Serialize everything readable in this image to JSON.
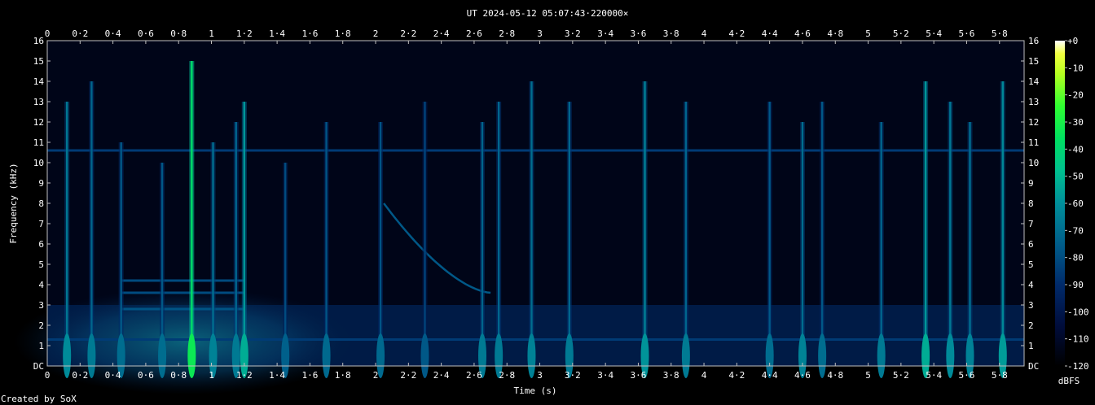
{
  "chart_data": {
    "type": "heatmap",
    "title": "UT 2024-05-12 05:07:43·220000×",
    "xlabel": "Time (s)",
    "ylabel": "Frequency (kHz)",
    "xlim": [
      0,
      5.95
    ],
    "ylim": [
      0,
      16
    ],
    "x_ticks": [
      "0",
      "0·2",
      "0·4",
      "0·6",
      "0·8",
      "1",
      "1·2",
      "1·4",
      "1·6",
      "1·8",
      "2",
      "2·2",
      "2·4",
      "2·6",
      "2·8",
      "3",
      "3·2",
      "3·4",
      "3·6",
      "3·8",
      "4",
      "4·2",
      "4·4",
      "4·6",
      "4·8",
      "5",
      "5·2",
      "5·4",
      "5·6",
      "5·8"
    ],
    "x_tick_values": [
      0,
      0.2,
      0.4,
      0.6,
      0.8,
      1,
      1.2,
      1.4,
      1.6,
      1.8,
      2,
      2.2,
      2.4,
      2.6,
      2.8,
      3,
      3.2,
      3.4,
      3.6,
      3.8,
      4,
      4.2,
      4.4,
      4.6,
      4.8,
      5,
      5.2,
      5.4,
      5.6,
      5.8
    ],
    "y_ticks": [
      "DC",
      "1",
      "2",
      "3",
      "4",
      "5",
      "6",
      "7",
      "8",
      "9",
      "10",
      "11",
      "12",
      "13",
      "14",
      "15",
      "16"
    ],
    "colorbar": {
      "label": "dBFS",
      "ticks": [
        "+0",
        "-10",
        "-20",
        "-30",
        "-40",
        "-50",
        "-60",
        "-70",
        "-80",
        "-90",
        "-100",
        "-110",
        "-120"
      ],
      "range": [
        -120,
        0
      ],
      "colors": [
        "#ffffff",
        "#f2ff40",
        "#b8ff20",
        "#30ff30",
        "#00e060",
        "#00c090",
        "#008f9a",
        "#005c8a",
        "#002a6a",
        "#000c3a",
        "#000000"
      ]
    },
    "background_level_dbfs": -115,
    "low_band_level_dbfs": -95,
    "events": [
      {
        "t": 0.12,
        "f_top": 13,
        "level": -78
      },
      {
        "t": 0.27,
        "f_top": 14,
        "level": -82
      },
      {
        "t": 0.45,
        "f_top": 11,
        "level": -85
      },
      {
        "t": 0.7,
        "f_top": 10,
        "level": -85
      },
      {
        "t": 0.88,
        "f_top": 15,
        "level": -50
      },
      {
        "t": 1.01,
        "f_top": 11,
        "level": -80
      },
      {
        "t": 1.15,
        "f_top": 12,
        "level": -82
      },
      {
        "t": 1.2,
        "f_top": 13,
        "level": -70
      },
      {
        "t": 1.45,
        "f_top": 10,
        "level": -88
      },
      {
        "t": 1.7,
        "f_top": 12,
        "level": -86
      },
      {
        "t": 2.03,
        "f_top": 12,
        "level": -86
      },
      {
        "t": 2.3,
        "f_top": 13,
        "level": -90
      },
      {
        "t": 2.65,
        "f_top": 12,
        "level": -82
      },
      {
        "t": 2.75,
        "f_top": 13,
        "level": -82
      },
      {
        "t": 2.95,
        "f_top": 14,
        "level": -80
      },
      {
        "t": 3.18,
        "f_top": 13,
        "level": -82
      },
      {
        "t": 3.64,
        "f_top": 14,
        "level": -76
      },
      {
        "t": 3.89,
        "f_top": 13,
        "level": -82
      },
      {
        "t": 4.4,
        "f_top": 13,
        "level": -85
      },
      {
        "t": 4.6,
        "f_top": 12,
        "level": -80
      },
      {
        "t": 4.72,
        "f_top": 13,
        "level": -85
      },
      {
        "t": 5.08,
        "f_top": 12,
        "level": -82
      },
      {
        "t": 5.35,
        "f_top": 14,
        "level": -70
      },
      {
        "t": 5.5,
        "f_top": 13,
        "level": -78
      },
      {
        "t": 5.62,
        "f_top": 12,
        "level": -80
      },
      {
        "t": 5.82,
        "f_top": 14,
        "level": -74
      }
    ],
    "sweep": {
      "t_start": 2.05,
      "f_start": 8,
      "t_end": 2.7,
      "f_end": 3.6,
      "level": -85
    },
    "tone_bands": [
      {
        "f": 10.6,
        "t_start": 0,
        "t_end": 5.95,
        "level": -92
      },
      {
        "f": 4.2,
        "t_start": 0.45,
        "t_end": 1.2,
        "level": -88
      },
      {
        "f": 3.6,
        "t_start": 0.45,
        "t_end": 1.2,
        "level": -88
      },
      {
        "f": 2.8,
        "t_start": 0.45,
        "t_end": 1.2,
        "level": -86
      },
      {
        "f": 1.3,
        "t_start": 0.0,
        "t_end": 5.95,
        "level": -92
      }
    ]
  },
  "footer": {
    "credit": "Created by SoX"
  }
}
